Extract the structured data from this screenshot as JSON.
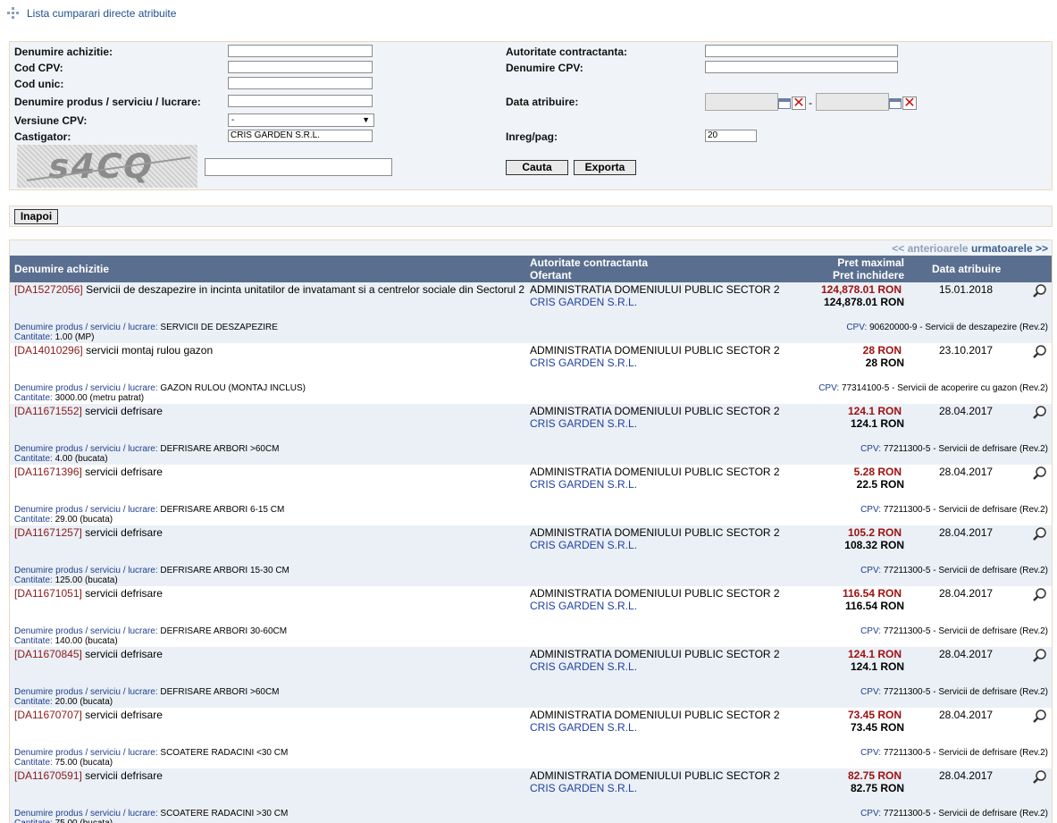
{
  "title": "Lista cumparari directe atribuite",
  "filters": {
    "denumire_achizitie_label": "Denumire achizitie:",
    "cod_cpv_label": "Cod CPV:",
    "cod_unic_label": "Cod unic:",
    "denumire_produs_label": "Denumire produs / serviciu / lucrare:",
    "versiune_cpv_label": "Versiune CPV:",
    "versiune_cpv_value": "-",
    "castigator_label": "Castigator:",
    "castigator_value": "CRIS GARDEN S.R.L.",
    "autoritate_label": "Autoritate contractanta:",
    "denumire_cpv_label": "Denumire CPV:",
    "data_atribuire_label": "Data atribuire:",
    "date_separator": "-",
    "inreg_label": "Inreg/pag:",
    "inreg_value": "20",
    "captcha_text": "s4CQ",
    "search_button": "Cauta",
    "export_button": "Exporta",
    "back_button": "Inapoi"
  },
  "pager": {
    "prev": "<< anterioarele",
    "next": "urmatoarele >>"
  },
  "table": {
    "col_name": "Denumire achizitie",
    "col_authority": "Autoritate contractanta",
    "col_bidder": "Ofertant",
    "col_max_price": "Pret maximal",
    "col_close_price": "Pret inchidere",
    "col_date": "Data atribuire",
    "detail_label": "Denumire produs / serviciu / lucrare:",
    "qty_label": "Cantitate:",
    "cpv_label": "CPV:",
    "rows": [
      {
        "code": "[DA15272056]",
        "name": " Servicii de deszapezire in incinta unitatilor de invatamant si a centrelor sociale din Sectorul 2",
        "authority": "ADMINISTRATIA DOMENIULUI PUBLIC SECTOR 2",
        "winner": "CRIS GARDEN S.R.L.",
        "max_price": "124,878.01 RON",
        "close_price": "124,878.01  RON",
        "date": "15.01.2018",
        "detail": "SERVICII DE DESZAPEZIRE",
        "qty": "1.00 (MP)",
        "cpv": "90620000-9 - Servicii de deszapezire (Rev.2)"
      },
      {
        "code": "[DA14010296]",
        "name": " servicii montaj rulou gazon",
        "authority": "ADMINISTRATIA DOMENIULUI PUBLIC SECTOR 2",
        "winner": "CRIS GARDEN S.R.L.",
        "max_price": "28 RON",
        "close_price": "28  RON",
        "date": "23.10.2017",
        "detail": "GAZON RULOU (MONTAJ INCLUS)",
        "qty": "3000.00 (metru patrat)",
        "cpv": "77314100-5 - Servicii de acoperire cu gazon (Rev.2)"
      },
      {
        "code": "[DA11671552]",
        "name": " servicii defrisare",
        "authority": "ADMINISTRATIA DOMENIULUI PUBLIC SECTOR 2",
        "winner": "CRIS GARDEN S.R.L.",
        "max_price": "124.1 RON",
        "close_price": "124.1  RON",
        "date": "28.04.2017",
        "detail": "DEFRISARE ARBORI >60CM",
        "qty": "4.00 (bucata)",
        "cpv": "77211300-5 - Servicii de defrisare (Rev.2)"
      },
      {
        "code": "[DA11671396]",
        "name": " servicii defrisare",
        "authority": "ADMINISTRATIA DOMENIULUI PUBLIC SECTOR 2",
        "winner": "CRIS GARDEN S.R.L.",
        "max_price": "5.28 RON",
        "close_price": "22.5  RON",
        "date": "28.04.2017",
        "detail": "DEFRISARE ARBORI 6-15 CM",
        "qty": "29.00 (bucata)",
        "cpv": "77211300-5 - Servicii de defrisare (Rev.2)"
      },
      {
        "code": "[DA11671257]",
        "name": " servicii defrisare",
        "authority": "ADMINISTRATIA DOMENIULUI PUBLIC SECTOR 2",
        "winner": "CRIS GARDEN S.R.L.",
        "max_price": "105.2 RON",
        "close_price": "108.32  RON",
        "date": "28.04.2017",
        "detail": "DEFRISARE ARBORI 15-30 CM",
        "qty": "125.00 (bucata)",
        "cpv": "77211300-5 - Servicii de defrisare (Rev.2)"
      },
      {
        "code": "[DA11671051]",
        "name": " servicii defrisare",
        "authority": "ADMINISTRATIA DOMENIULUI PUBLIC SECTOR 2",
        "winner": "CRIS GARDEN S.R.L.",
        "max_price": "116.54 RON",
        "close_price": "116.54  RON",
        "date": "28.04.2017",
        "detail": "DEFRISARE ARBORI 30-60CM",
        "qty": "140.00 (bucata)",
        "cpv": "77211300-5 - Servicii de defrisare (Rev.2)"
      },
      {
        "code": "[DA11670845]",
        "name": " servicii defrisare",
        "authority": "ADMINISTRATIA DOMENIULUI PUBLIC SECTOR 2",
        "winner": "CRIS GARDEN S.R.L.",
        "max_price": "124.1 RON",
        "close_price": "124.1  RON",
        "date": "28.04.2017",
        "detail": "DEFRISARE ARBORI >60CM",
        "qty": "20.00 (bucata)",
        "cpv": "77211300-5 - Servicii de defrisare (Rev.2)"
      },
      {
        "code": "[DA11670707]",
        "name": " servicii defrisare",
        "authority": "ADMINISTRATIA DOMENIULUI PUBLIC SECTOR 2",
        "winner": "CRIS GARDEN S.R.L.",
        "max_price": "73.45 RON",
        "close_price": "73.45  RON",
        "date": "28.04.2017",
        "detail": "SCOATERE RADACINI <30 CM",
        "qty": "75.00 (bucata)",
        "cpv": "77211300-5 - Servicii de defrisare (Rev.2)"
      },
      {
        "code": "[DA11670591]",
        "name": " servicii defrisare",
        "authority": "ADMINISTRATIA DOMENIULUI PUBLIC SECTOR 2",
        "winner": "CRIS GARDEN S.R.L.",
        "max_price": "82.75 RON",
        "close_price": "82.75  RON",
        "date": "28.04.2017",
        "detail": "SCOATERE RADACINI >30 CM",
        "qty": "75.00 (bucata)",
        "cpv": "77211300-5 - Servicii de defrisare (Rev.2)"
      }
    ]
  }
}
